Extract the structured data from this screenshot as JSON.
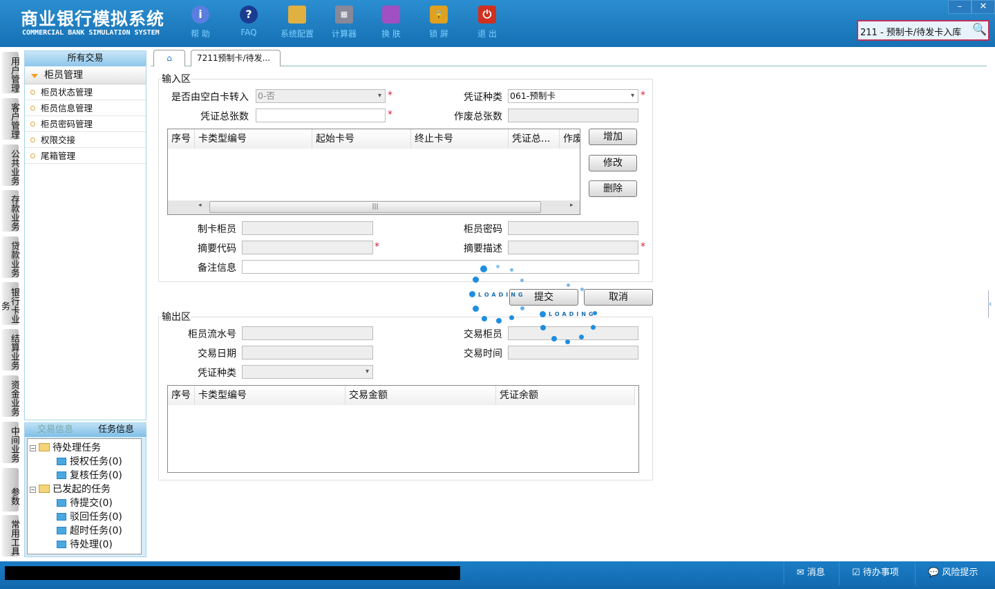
{
  "app": {
    "title": "商业银行模拟系统",
    "subtitle": "COMMERCIAL BANK SIMULATION SYSTEM"
  },
  "toolbar": [
    {
      "label": "帮 助",
      "icon": "info-icon"
    },
    {
      "label": "FAQ",
      "icon": "question-icon"
    },
    {
      "label": "系统配置",
      "icon": "toolbox-icon"
    },
    {
      "label": "计算器",
      "icon": "calculator-icon"
    },
    {
      "label": "换 肤",
      "icon": "shirt-icon"
    },
    {
      "label": "锁 屏",
      "icon": "lock-icon"
    },
    {
      "label": "退 出",
      "icon": "power-icon"
    }
  ],
  "window": {
    "minimize": "–",
    "close": "✕"
  },
  "search": {
    "value": "211 - 预制卡/待发卡入库"
  },
  "side_tabs": [
    "用户管理",
    "客户管理",
    "公共业务",
    "存款业务",
    "贷款业务",
    "银行卡业务",
    "结算业务",
    "资金业务",
    "中间业务",
    "参数",
    "常用工具"
  ],
  "menu": {
    "header": "所有交易",
    "group": "柜员管理",
    "items": [
      "柜员状态管理",
      "柜员信息管理",
      "柜员密码管理",
      "权限交接",
      "尾箱管理"
    ]
  },
  "task_panel": {
    "tabs": [
      "交易信息",
      "任务信息"
    ],
    "tree": [
      {
        "label": "待处理任务",
        "children": [
          "授权任务(0)",
          "复核任务(0)"
        ]
      },
      {
        "label": "已发起的任务",
        "children": [
          "待提交(0)",
          "驳回任务(0)",
          "超时任务(0)",
          "待处理(0)"
        ]
      }
    ]
  },
  "tabs": {
    "active": "7211预制卡/待发..."
  },
  "input": {
    "legend": "输入区",
    "from_blank_label": "是否由空白卡转入",
    "from_blank_value": "0-否",
    "voucher_type_label": "凭证种类",
    "voucher_type_value": "061-预制卡",
    "total_label": "凭证总张数",
    "total_value": "",
    "void_label": "作废总张数",
    "void_value": "",
    "grid_headers": [
      "序号",
      "卡类型编号",
      "起始卡号",
      "终止卡号",
      "凭证总...",
      "作废"
    ],
    "buttons": {
      "add": "增加",
      "edit": "修改",
      "delete": "删除"
    },
    "maker_label": "制卡柜员",
    "pwd_label": "柜员密码",
    "summary_code_label": "摘要代码",
    "summary_desc_label": "摘要描述",
    "remark_label": "备注信息",
    "required_mark": "*"
  },
  "actions": {
    "submit": "提交",
    "cancel": "取消"
  },
  "loading": "LOADING",
  "output": {
    "legend": "输出区",
    "serial_label": "柜员流水号",
    "teller_label": "交易柜员",
    "date_label": "交易日期",
    "time_label": "交易时间",
    "voucher_type_label": "凭证种类",
    "grid_headers": [
      "序号",
      "卡类型编号",
      "交易金额",
      "凭证余额"
    ]
  },
  "statusbar": {
    "message": "消息",
    "todo": "待办事项",
    "risk": "风险提示"
  }
}
